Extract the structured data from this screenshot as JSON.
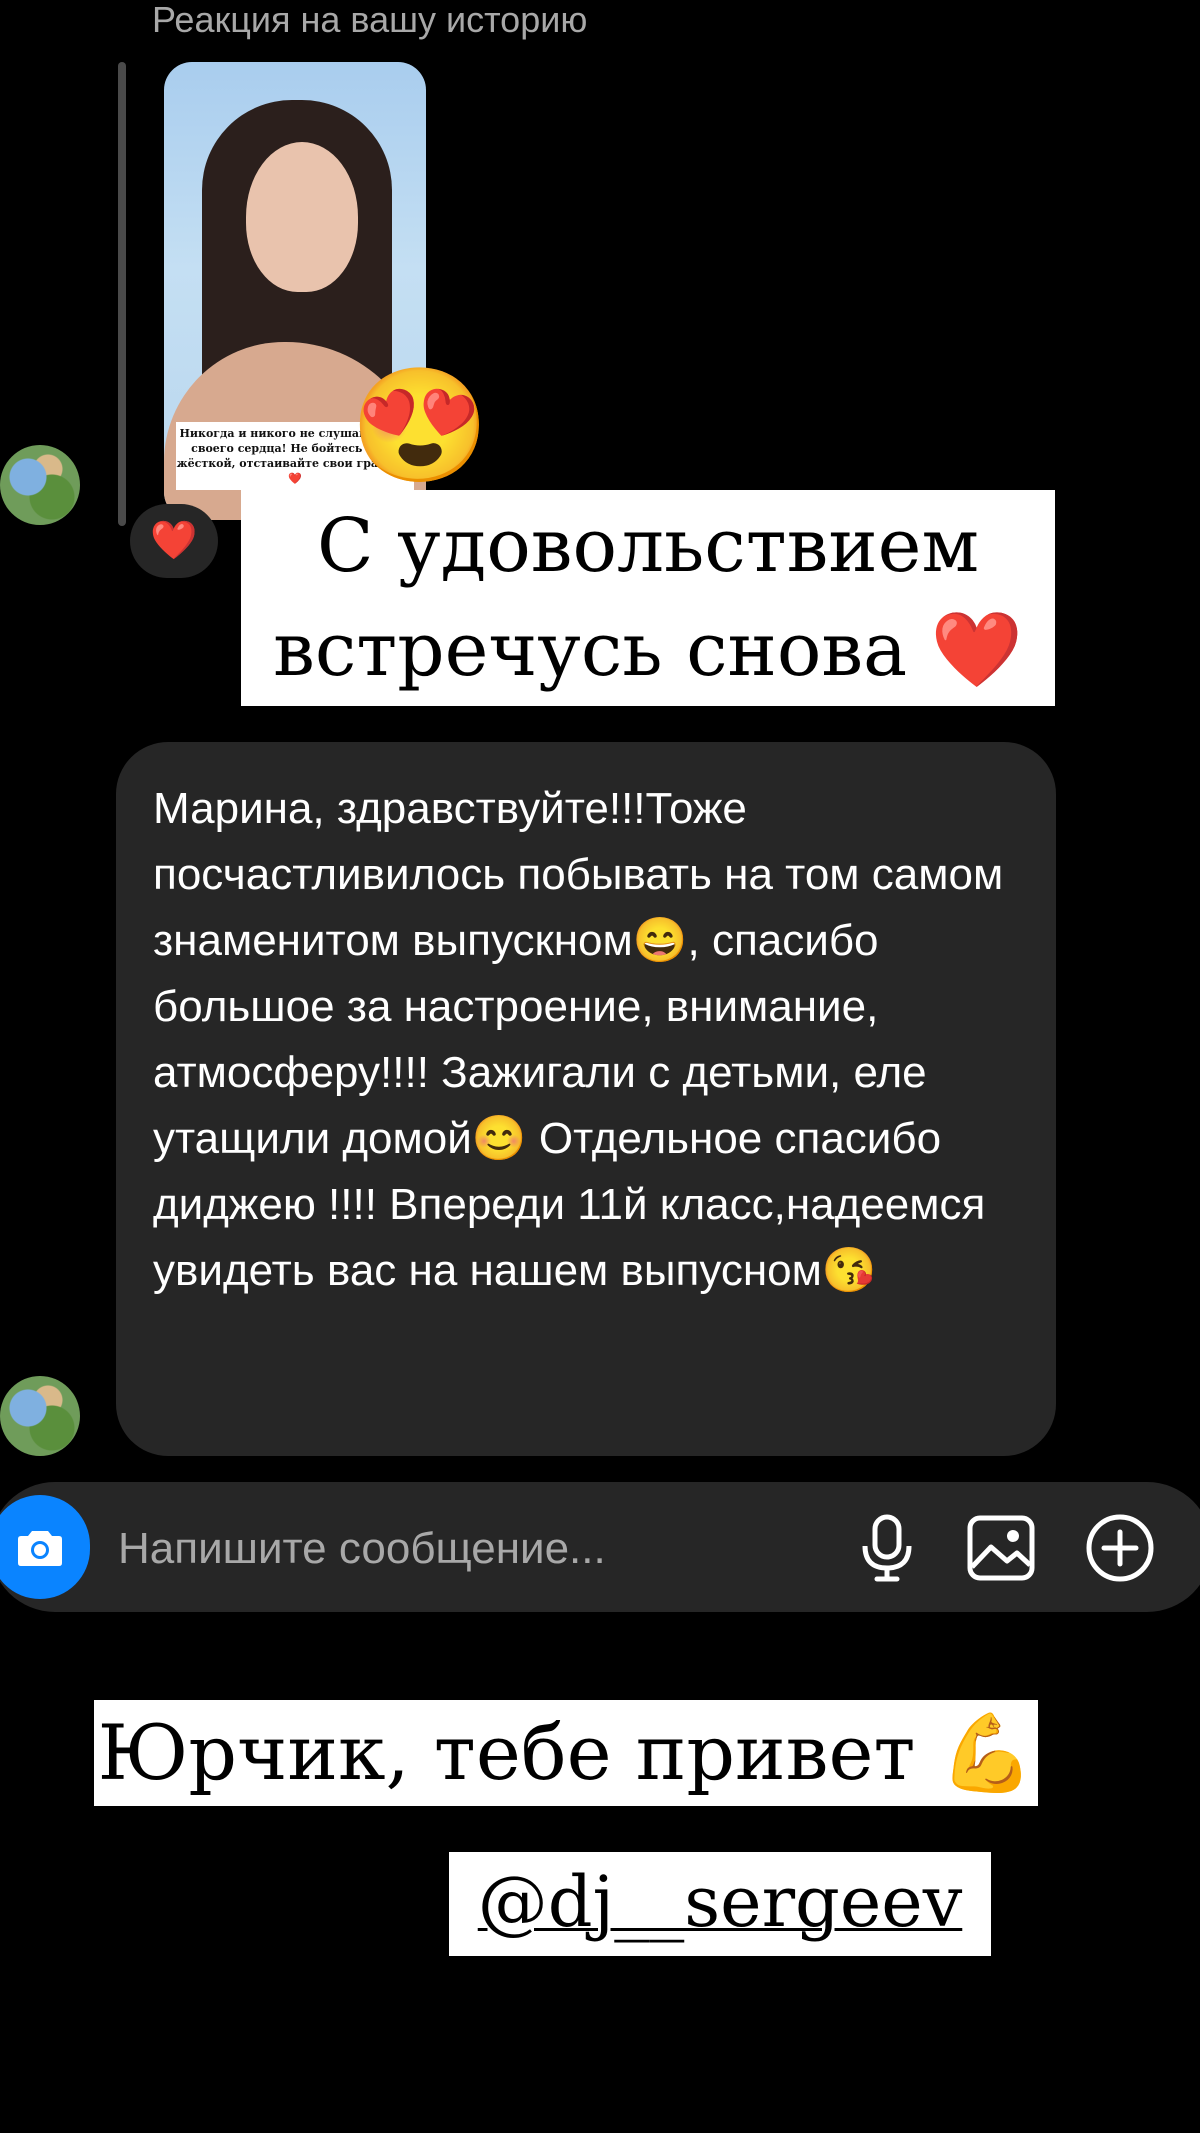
{
  "story_reply": {
    "label": "Реакция на вашу историю",
    "story_caption": "Никогда и никого не слушай кроме своего сердца! Не бойтесь быть жёсткой, отстаивайте свои границы❤️",
    "overlay_emoji": "😍",
    "reaction": "❤️"
  },
  "stickers": {
    "top_text": "С удовольствием встречусь снова ❤️",
    "greeting": "Юрчик, тебе привет 💪",
    "mention": "@dj__sergeev"
  },
  "message": {
    "text": "Марина, здравствуйте!!!Тоже посчастливилось побывать на том самом знаменитом выпускном😄, спасибо большое за настроение, внимание, атмосферу!!!! Зажигали с детьми, еле утащили домой😊 Отдельное спасибо диджею  !!!! Впереди 11й класс,надеемся увидеть вас на нашем выпусном😘"
  },
  "composer": {
    "placeholder": "Напишите сообщение..."
  },
  "icons": {
    "camera": "camera-icon",
    "microphone": "microphone-icon",
    "gallery": "gallery-icon",
    "add": "plus-circle-icon"
  },
  "colors": {
    "background": "#000000",
    "bubble": "#262626",
    "accent": "#0a84ff",
    "muted_text": "#a8a8a8"
  }
}
